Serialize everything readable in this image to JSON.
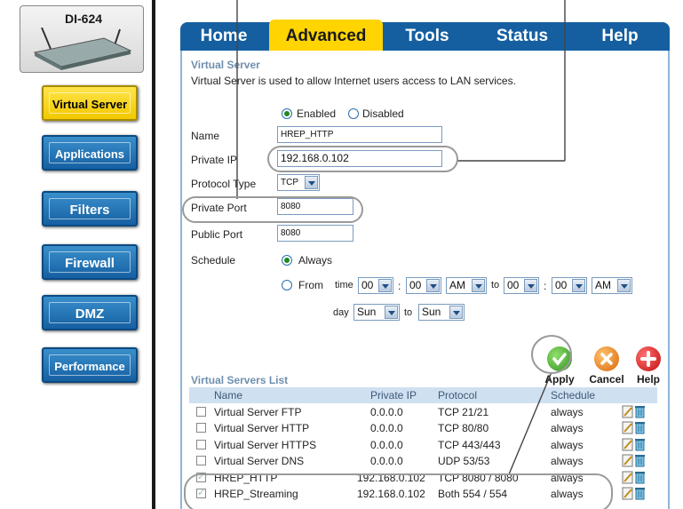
{
  "device": {
    "model": "DI-624"
  },
  "sidebar": {
    "items": [
      {
        "label": "Virtual Server",
        "active": true
      },
      {
        "label": "Applications",
        "active": false
      },
      {
        "label": "Filters",
        "active": false
      },
      {
        "label": "Firewall",
        "active": false
      },
      {
        "label": "DMZ",
        "active": false
      },
      {
        "label": "Performance",
        "active": false
      }
    ]
  },
  "tabs": [
    {
      "label": "Home",
      "active": false
    },
    {
      "label": "Advanced",
      "active": true
    },
    {
      "label": "Tools",
      "active": false
    },
    {
      "label": "Status",
      "active": false
    },
    {
      "label": "Help",
      "active": false
    }
  ],
  "virtual_server": {
    "title": "Virtual Server",
    "description": "Virtual Server is used to allow Internet users access to LAN services.",
    "enabled_label": "Enabled",
    "disabled_label": "Disabled",
    "enabled": true,
    "name_label": "Name",
    "name_value": "HREP_HTTP",
    "private_ip_label": "Private IP",
    "private_ip_value": "192.168.0.102",
    "protocol_type_label": "Protocol Type",
    "protocol_type_value": "TCP",
    "private_port_label": "Private Port",
    "private_port_value": "8080",
    "public_port_label": "Public Port",
    "public_port_value": "8080",
    "schedule_label": "Schedule",
    "always_label": "Always",
    "from_label": "From",
    "time_label": "time",
    "from_hour": "00",
    "from_min": "00",
    "from_ampm": "AM",
    "to_label": "to",
    "to_hour": "00",
    "to_min": "00",
    "to_ampm": "AM",
    "day_label": "day",
    "day_from": "Sun",
    "day_to": "Sun",
    "colon": ":"
  },
  "actions": {
    "apply": "Apply",
    "cancel": "Cancel",
    "help": "Help"
  },
  "list": {
    "title": "Virtual Servers List",
    "headers": {
      "name": "Name",
      "private_ip": "Private IP",
      "protocol": "Protocol",
      "schedule": "Schedule"
    },
    "rows": [
      {
        "name": "Virtual Server FTP",
        "ip": "0.0.0.0",
        "protocol": "TCP 21/21",
        "schedule": "always",
        "checked": false
      },
      {
        "name": "Virtual Server HTTP",
        "ip": "0.0.0.0",
        "protocol": "TCP 80/80",
        "schedule": "always",
        "checked": false
      },
      {
        "name": "Virtual Server HTTPS",
        "ip": "0.0.0.0",
        "protocol": "TCP 443/443",
        "schedule": "always",
        "checked": false
      },
      {
        "name": "Virtual Server DNS",
        "ip": "0.0.0.0",
        "protocol": "UDP 53/53",
        "schedule": "always",
        "checked": false
      },
      {
        "name": "HREP_HTTP",
        "ip": "192.168.0.102",
        "protocol": "TCP 8080 / 8080",
        "schedule": "always",
        "checked": true
      },
      {
        "name": "HREP_Streaming",
        "ip": "192.168.0.102",
        "protocol": "Both 554 / 554",
        "schedule": "always",
        "checked": true
      }
    ]
  },
  "colors": {
    "tab_bar": "#155fa1",
    "tab_active": "#ffd400",
    "sidebar_blue": "#1660a3",
    "sidebar_active": "#ffd400",
    "apply_green": "#3aa12a",
    "cancel_orange": "#e8801c",
    "help_red": "#d91a1a"
  }
}
